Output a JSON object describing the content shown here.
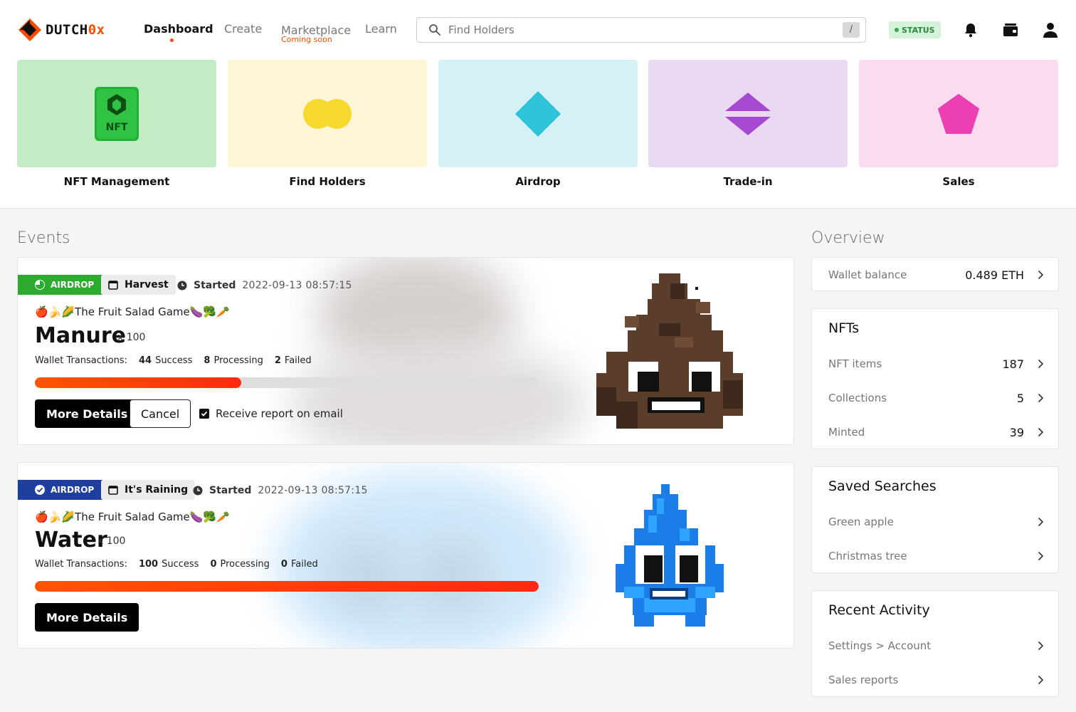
{
  "header": {
    "brand": {
      "prefix": "DUTCH",
      "suffix": "0x"
    },
    "nav": {
      "dashboard": "Dashboard",
      "create": "Create",
      "marketplace": "Marketplace",
      "marketplace_note": "Coming soon",
      "learn": "Learn"
    },
    "search": {
      "placeholder": "Find Holders",
      "shortcut": "/"
    },
    "status": "STATUS",
    "icons": [
      "bell-icon",
      "wallet-icon",
      "user-icon"
    ]
  },
  "tiles": [
    {
      "label": "NFT Management",
      "bg": "#c3ecc4",
      "icon_text": "NFT"
    },
    {
      "label": "Find Holders",
      "bg": "#fdf6d6"
    },
    {
      "label": "Airdrop",
      "bg": "#d6f1f6"
    },
    {
      "label": "Trade-in",
      "bg": "#ead9f3"
    },
    {
      "label": "Sales",
      "bg": "#fadcee"
    }
  ],
  "events": {
    "title": "Events",
    "items": [
      {
        "badge": "AIRDROP",
        "badge_color": "#2cab2f",
        "tag": "Harvest",
        "started_label": "Started",
        "started_at": "2022-09-13 08:57:15",
        "game": "🍎🍌🌽The Fruit Salad Game🍆🥦🥕",
        "name": "Manure",
        "qty": "x 100",
        "tx_label": "Wallet Transactions:",
        "success_n": "44",
        "success_l": "Success",
        "processing_n": "8",
        "processing_l": "Processing",
        "failed_n": "2",
        "failed_l": "Failed",
        "progress": 0.41,
        "more": "More Details",
        "cancel": "Cancel",
        "report": "Receive report on email"
      },
      {
        "badge": "AIRDROP",
        "badge_color": "#1f3f9e",
        "tag": "It's Raining",
        "started_label": "Started",
        "started_at": "2022-09-13 08:57:15",
        "game": "🍎🍌🌽The Fruit Salad Game🍆🥦🥕",
        "name": "Water",
        "qty": "x 100",
        "tx_label": "Wallet Transactions:",
        "success_n": "100",
        "success_l": "Success",
        "processing_n": "0",
        "processing_l": "Processing",
        "failed_n": "0",
        "failed_l": "Failed",
        "progress": 1.0,
        "more": "More Details"
      }
    ]
  },
  "overview": {
    "title": "Overview",
    "wallet": {
      "label": "Wallet balance",
      "value": "0.489 ETH"
    },
    "nfts": {
      "title": "NFTs",
      "rows": [
        {
          "label": "NFT items",
          "value": "187"
        },
        {
          "label": "Collections",
          "value": "5"
        },
        {
          "label": "Minted",
          "value": "39"
        }
      ]
    },
    "saved": {
      "title": "Saved Searches",
      "rows": [
        {
          "label": "Green apple"
        },
        {
          "label": "Christmas tree"
        }
      ]
    },
    "recent": {
      "title": "Recent Activity",
      "rows": [
        {
          "label": "Settings > Account"
        },
        {
          "label": "Sales reports"
        }
      ]
    }
  }
}
